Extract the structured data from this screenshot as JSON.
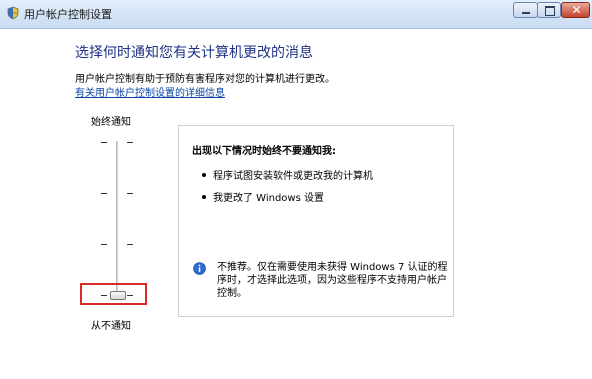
{
  "window": {
    "title": "用户帐户控制设置",
    "buttons": {
      "minimize": "minimize",
      "maximize": "maximize",
      "close": "✕"
    },
    "icons": {
      "app": "shield-icon"
    }
  },
  "main": {
    "heading": "选择何时通知您有关计算机更改的消息",
    "description": "用户帐户控制有助于预防有害程序对您的计算机进行更改。",
    "link": "有关用户帐户控制设置的详细信息"
  },
  "slider": {
    "top_label": "始终通知",
    "bottom_label": "从不通知",
    "levels": 4,
    "selected_level": 1,
    "selected_fraction": 0.0
  },
  "panel": {
    "heading": "出现以下情况时始终不要通知我:",
    "items": [
      "程序试图安装软件或更改我的计算机",
      "我更改了 Windows 设置"
    ],
    "note_lines": [
      "不推荐。仅在需要使用未获得 Windows 7 认证的程",
      "序时，才选择此选项，因为这些程序不支持用户帐户",
      "控制。"
    ],
    "note_icon": "info-icon"
  },
  "colors": {
    "heading": "#1e3287",
    "link": "#0b46a8",
    "highlight": "#d82a2a",
    "titlebar": "#c9dcf2"
  }
}
